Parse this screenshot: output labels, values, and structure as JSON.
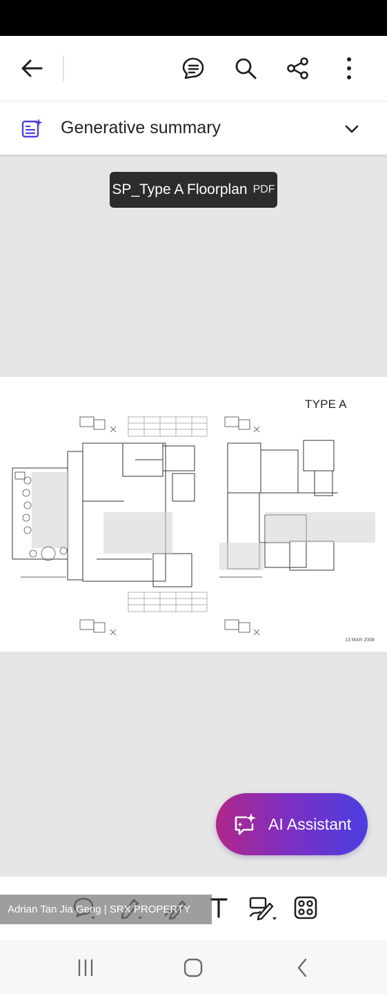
{
  "summary": {
    "title": "Generative summary"
  },
  "document": {
    "name": "SP_Type A Floorplan",
    "type": "PDF"
  },
  "floorplan": {
    "heading": "TYPE A",
    "date_note": "13 MAR 2008"
  },
  "assistant": {
    "label": "AI Assistant"
  },
  "watermark": {
    "text": "Adrian Tan Jia Geng | SRX PROPERTY"
  },
  "colors": {
    "accent_gradient": [
      "#b0278a",
      "#7b2fc4",
      "#4a3fe0"
    ],
    "summary_icon": "#4a3fe0",
    "toolbar_bg": "#ffffff",
    "canvas_bg": "#e6e6e6"
  },
  "icons": {
    "toolbar": [
      "back-arrow-icon",
      "comment-list-icon",
      "search-icon",
      "share-icon",
      "more-vertical-icon"
    ],
    "bottom_tools": [
      "comment-icon",
      "highlight-icon",
      "draw-icon",
      "text-icon",
      "fill-sign-icon",
      "more-tools-icon"
    ],
    "nav": [
      "recents-icon",
      "home-icon",
      "back-icon"
    ]
  }
}
